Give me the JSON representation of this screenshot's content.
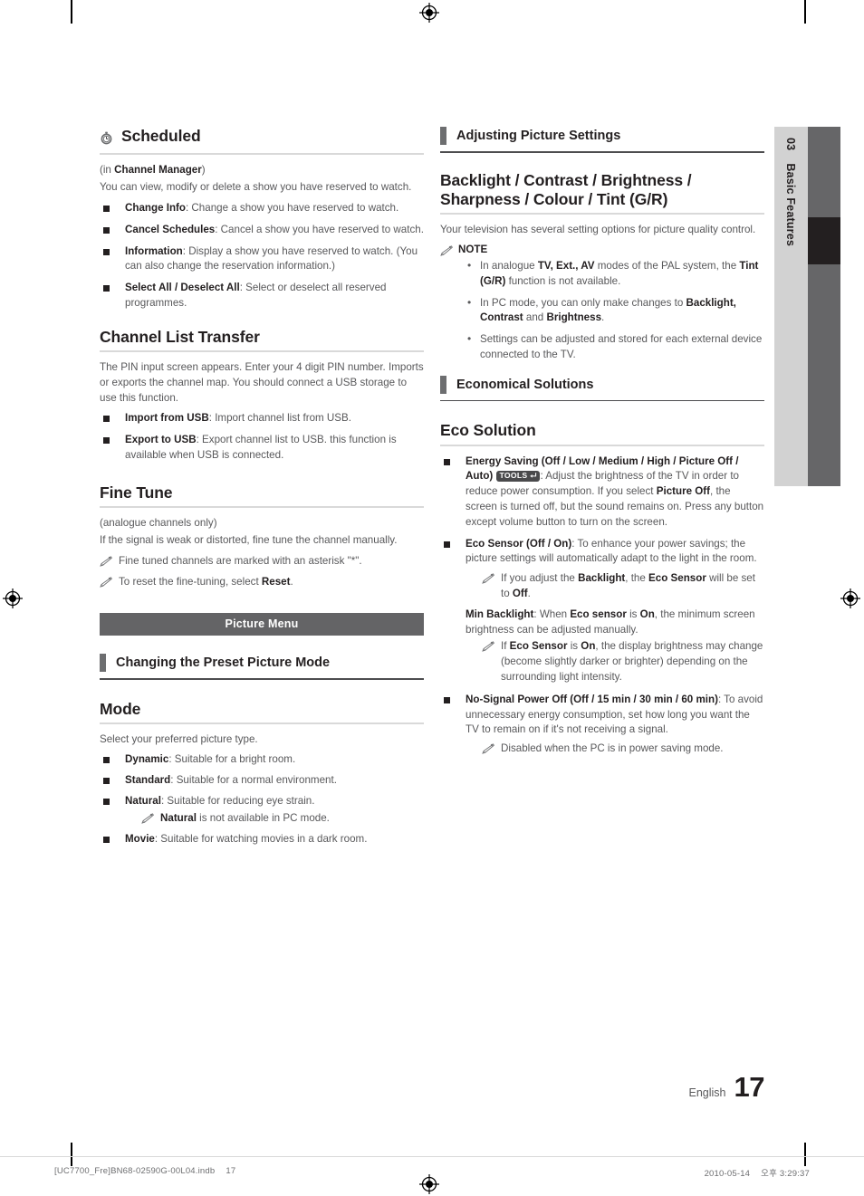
{
  "document": {
    "side_tab": {
      "chapter_number": "03",
      "chapter_title": "Basic Features"
    },
    "page_footer": {
      "language": "English",
      "page_number": "17"
    },
    "production_footer": {
      "file_name": "[UC7700_Fre]BN68-02590G-00L04.indb",
      "file_page": "17",
      "date": "2010-05-14",
      "time": "오후 3:29:37"
    },
    "colors": {
      "heading": "#231f20",
      "body_text": "#58585a",
      "rule": "#d9d9d9",
      "banner_bg": "#646466",
      "side_tab_bg": "#d2d2d2",
      "side_bar_bg": "#666668",
      "side_bar_active": "#231f20",
      "tools_badge_bg": "#4a4a4c"
    }
  },
  "left_column": {
    "scheduled": {
      "icon": "clock-icon",
      "title": "Scheduled",
      "subtitle_prefix": "(in ",
      "subtitle_bold": "Channel Manager",
      "subtitle_suffix": ")",
      "intro": "You can view, modify or delete a show you have reserved to watch.",
      "items": [
        {
          "term": "Change Info",
          "desc": ": Change a show you have reserved to watch."
        },
        {
          "term": "Cancel Schedules",
          "desc": ": Cancel a show you have reserved to watch."
        },
        {
          "term": "Information",
          "desc": ": Display a show you have reserved to watch. (You can also change the reservation information.)"
        },
        {
          "term": "Select All / Deselect All",
          "desc": ": Select or deselect all reserved programmes."
        }
      ]
    },
    "channel_list_transfer": {
      "title": "Channel List Transfer",
      "intro": "The PIN input screen appears. Enter your 4 digit PIN number. Imports or exports the channel map. You should connect a USB storage to use this function.",
      "items": [
        {
          "term": "Import from USB",
          "desc": ": Import channel list from USB."
        },
        {
          "term": "Export to USB",
          "desc": ": Export channel list to USB. this function is available when USB is connected."
        }
      ]
    },
    "fine_tune": {
      "title": "Fine Tune",
      "subtitle": "(analogue channels only)",
      "intro": "If the signal is weak or distorted, fine tune the channel manually.",
      "notes": [
        {
          "text": "Fine tuned channels are marked with an asterisk \"*\"."
        },
        {
          "text_prefix": "To reset the fine-tuning, select ",
          "bold": "Reset",
          "text_suffix": "."
        }
      ]
    },
    "picture_menu_banner": "Picture Menu",
    "changing_preset": {
      "title": "Changing the Preset Picture Mode"
    },
    "mode": {
      "title": "Mode",
      "intro": "Select your preferred picture type.",
      "items": [
        {
          "term": "Dynamic",
          "desc": ": Suitable for a bright room."
        },
        {
          "term": "Standard",
          "desc": ": Suitable for a normal environment."
        },
        {
          "term": "Natural",
          "desc": ": Suitable for reducing eye strain.",
          "note": {
            "bold": "Natural",
            "text_suffix": " is not available in PC mode."
          }
        },
        {
          "term": "Movie",
          "desc": ": Suitable for watching movies in a dark room."
        }
      ]
    }
  },
  "right_column": {
    "adjusting_picture_settings": {
      "title": "Adjusting Picture Settings"
    },
    "backlight_group": {
      "title_line1": "Backlight / Contrast / Brightness /",
      "title_line2": "Sharpness / Colour / Tint (G/R)",
      "intro": "Your television has several setting options for picture quality control.",
      "note_label": "NOTE",
      "notes": [
        {
          "p1": "In analogue ",
          "b1": "TV, Ext., AV",
          "p2": " modes of the PAL system, the ",
          "b2": "Tint (G/R)",
          "p3": " function is not available."
        },
        {
          "p1": "In PC mode, you can only make changes to ",
          "b1": "Backlight, Contrast",
          "p2": " and ",
          "b2": "Brightness",
          "p3": "."
        },
        {
          "p1": "Settings can be adjusted and stored for each external device connected to the TV.",
          "b1": "",
          "p2": "",
          "b2": "",
          "p3": ""
        }
      ]
    },
    "economical_solutions": {
      "title": "Economical Solutions"
    },
    "eco_solution": {
      "title": "Eco Solution",
      "energy_saving": {
        "term": "Energy Saving (Off / Low / Medium / High / Picture Off / Auto)",
        "badge": "TOOLS",
        "badge_icon": "tools-enter-arrow-icon",
        "desc_part1": ": Adjust the brightness of the TV in order to reduce power consumption. If you select ",
        "desc_bold": "Picture Off",
        "desc_part2": ", the screen is turned off, but the sound remains on. Press any button except volume button to turn on the screen."
      },
      "eco_sensor": {
        "term": "Eco Sensor (Off / On)",
        "desc": ": To enhance your power savings; the picture settings will automatically adapt to the light in the room.",
        "note": {
          "p1": "If you adjust the ",
          "b1": "Backlight",
          "p2": ", the ",
          "b2": "Eco Sensor",
          "p3": " will be set to ",
          "b3": "Off",
          "p4": "."
        }
      },
      "min_backlight": {
        "term": "Min Backlight",
        "p1": ": When ",
        "b1": "Eco sensor",
        "p2": " is ",
        "b2": "On",
        "p3": ", the minimum screen brightness can be adjusted manually.",
        "note": {
          "p1": "If ",
          "b1": "Eco Sensor",
          "p2": " is ",
          "b2": "On",
          "p3": ", the display brightness may change (become slightly darker or brighter) depending on the surrounding light intensity."
        }
      },
      "no_signal_power_off": {
        "term": "No-Signal Power Off (Off / 15 min / 30 min / 60 min)",
        "desc": ": To avoid unnecessary energy consumption, set how long you want the TV to remain on if it's not receiving a signal.",
        "note": "Disabled when the PC is in power saving mode."
      }
    }
  }
}
